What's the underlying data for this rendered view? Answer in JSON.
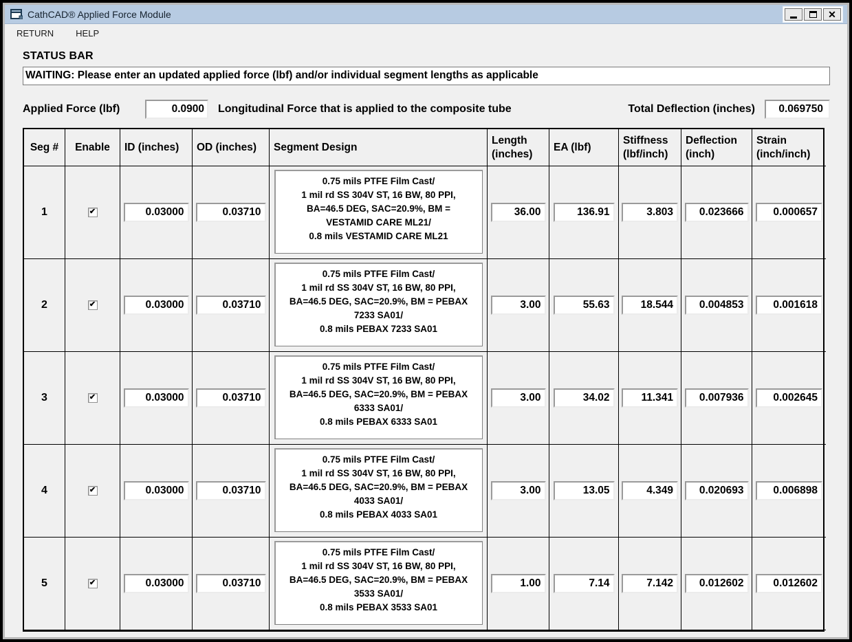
{
  "window": {
    "title": "CathCAD® Applied Force Module",
    "icons": {
      "app": "form-window-icon",
      "minimize": "minimize-icon",
      "maximize": "maximize-icon",
      "close": "close-icon"
    }
  },
  "icons": {
    "check": "✔",
    "close": "✕"
  },
  "colors": {
    "titlebar": "#b7cbe2",
    "body": "#f0f0f0",
    "table_border": "#000000",
    "box_bg": "#ffffff"
  },
  "menu": {
    "return_label": "RETURN",
    "help_label": "HELP"
  },
  "status": {
    "label": "STATUS BAR",
    "message": "WAITING: Please enter an updated applied force (lbf) and/or individual segment lengths as applicable"
  },
  "applied_force": {
    "label": "Applied Force (lbf)",
    "value": "0.0900",
    "description": "Longitudinal Force that is applied to the composite tube"
  },
  "total_deflection": {
    "label": "Total Deflection (inches)",
    "value": "0.069750"
  },
  "table": {
    "headers": [
      "Seg #",
      "Enable",
      "ID (inches)",
      "OD (inches)",
      "Segment Design",
      "Length (inches)",
      "EA (lbf)",
      "Stiffness (lbf/inch)",
      "Deflection (inch)",
      "Strain (inch/inch)"
    ],
    "rows": [
      {
        "seg": "1",
        "enabled": true,
        "id": "0.03000",
        "od": "0.03710",
        "design": "0.75 mils PTFE Film Cast/\n1 mil rd SS 304V ST, 16 BW, 80 PPI,\nBA=46.5 DEG, SAC=20.9%, BM =\nVESTAMID CARE ML21/\n0.8 mils VESTAMID CARE ML21",
        "length": "36.00",
        "ea": "136.91",
        "stiffness": "3.803",
        "deflection": "0.023666",
        "strain": "0.000657"
      },
      {
        "seg": "2",
        "enabled": true,
        "id": "0.03000",
        "od": "0.03710",
        "design": "0.75 mils PTFE Film Cast/\n1 mil rd SS 304V ST, 16 BW, 80 PPI,\nBA=46.5 DEG, SAC=20.9%, BM = PEBAX\n7233 SA01/\n0.8 mils PEBAX 7233 SA01",
        "length": "3.00",
        "ea": "55.63",
        "stiffness": "18.544",
        "deflection": "0.004853",
        "strain": "0.001618"
      },
      {
        "seg": "3",
        "enabled": true,
        "id": "0.03000",
        "od": "0.03710",
        "design": "0.75 mils PTFE Film Cast/\n1 mil rd SS 304V ST, 16 BW, 80 PPI,\nBA=46.5 DEG, SAC=20.9%, BM = PEBAX\n6333 SA01/\n0.8 mils PEBAX 6333 SA01",
        "length": "3.00",
        "ea": "34.02",
        "stiffness": "11.341",
        "deflection": "0.007936",
        "strain": "0.002645"
      },
      {
        "seg": "4",
        "enabled": true,
        "id": "0.03000",
        "od": "0.03710",
        "design": "0.75 mils PTFE Film Cast/\n1 mil rd SS 304V ST, 16 BW, 80 PPI,\nBA=46.5 DEG, SAC=20.9%, BM = PEBAX\n4033 SA01/\n0.8 mils PEBAX 4033 SA01",
        "length": "3.00",
        "ea": "13.05",
        "stiffness": "4.349",
        "deflection": "0.020693",
        "strain": "0.006898"
      },
      {
        "seg": "5",
        "enabled": true,
        "id": "0.03000",
        "od": "0.03710",
        "design": "0.75 mils PTFE Film Cast/\n1 mil rd SS 304V ST, 16 BW, 80 PPI,\nBA=46.5 DEG, SAC=20.9%, BM = PEBAX\n3533 SA01/\n0.8 mils PEBAX 3533 SA01",
        "length": "1.00",
        "ea": "7.14",
        "stiffness": "7.142",
        "deflection": "0.012602",
        "strain": "0.012602"
      }
    ]
  }
}
